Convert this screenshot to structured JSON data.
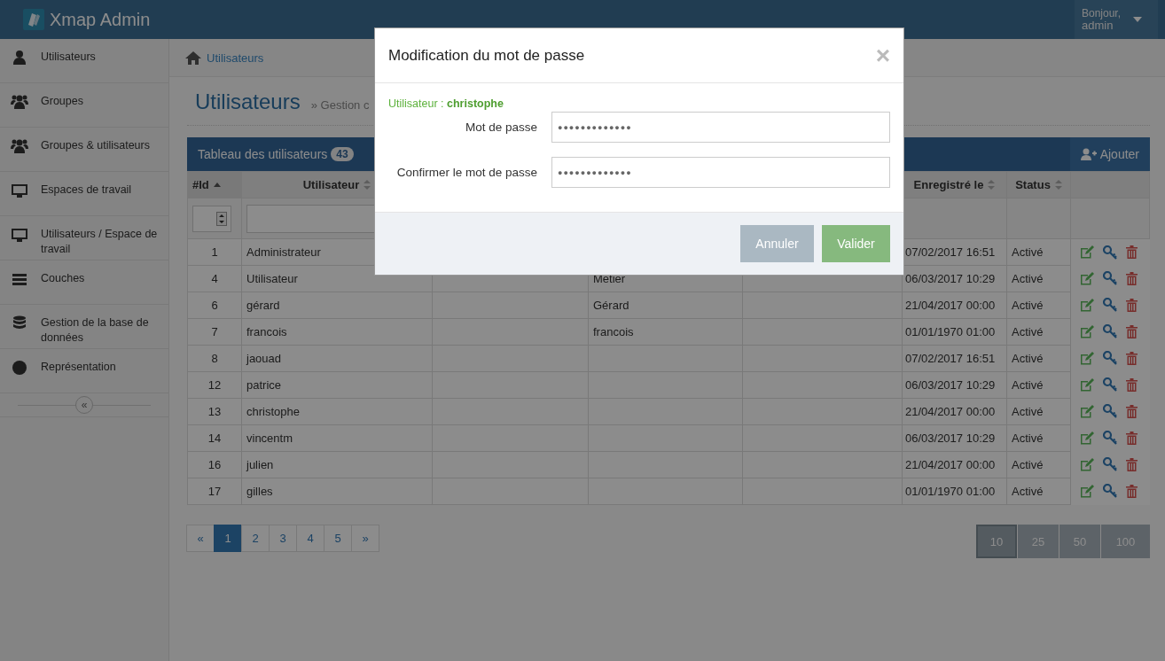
{
  "app": {
    "title": "Xmap Admin",
    "greeting": "Bonjour,",
    "user": "admin"
  },
  "sidebar": {
    "items": [
      {
        "label": "Utilisateurs"
      },
      {
        "label": "Groupes"
      },
      {
        "label": "Groupes & utilisateurs"
      },
      {
        "label": "Espaces de travail"
      },
      {
        "label": "Utilisateurs / Espace de travail"
      },
      {
        "label": "Couches"
      },
      {
        "label": "Gestion de la base de données"
      },
      {
        "label": "Représentation"
      }
    ],
    "collapse": "«"
  },
  "breadcrumb": "Utilisateurs",
  "page": {
    "title": "Utilisateurs",
    "subtitle": "» Gestion c"
  },
  "panel": {
    "title": "Tableau des utilisateurs",
    "count": "43",
    "add_button": "Ajouter"
  },
  "table": {
    "columns": [
      "#Id",
      "Utilisateur",
      "Enregistré le",
      "Status"
    ],
    "rows": [
      {
        "id": "1",
        "user": "Administrateur",
        "registered": "07/02/2017 16:51",
        "status": "Activé"
      },
      {
        "id": "4",
        "user": "Utilisateur",
        "column_4": "Metier",
        "registered": "06/03/2017 10:29",
        "status": "Activé"
      },
      {
        "id": "6",
        "user": "gérard",
        "column_4": "Gérard",
        "registered": "21/04/2017 00:00",
        "status": "Activé"
      },
      {
        "id": "7",
        "user": "francois",
        "column_4": "francois",
        "registered": "01/01/1970 01:00",
        "status": "Activé"
      },
      {
        "id": "8",
        "user": "jaouad",
        "registered": "07/02/2017 16:51",
        "status": "Activé"
      },
      {
        "id": "12",
        "user": "patrice",
        "registered": "06/03/2017 10:29",
        "status": "Activé"
      },
      {
        "id": "13",
        "user": "christophe",
        "registered": "21/04/2017 00:00",
        "status": "Activé"
      },
      {
        "id": "14",
        "user": "vincentm",
        "registered": "06/03/2017 10:29",
        "status": "Activé"
      },
      {
        "id": "16",
        "user": "julien",
        "registered": "21/04/2017 00:00",
        "status": "Activé"
      },
      {
        "id": "17",
        "user": "gilles",
        "registered": "01/01/1970 01:00",
        "status": "Activé"
      }
    ]
  },
  "pagination": {
    "prev": "«",
    "next": "»",
    "pages": [
      {
        "label": "1",
        "selected": true
      },
      {
        "label": "2",
        "selected": false
      },
      {
        "label": "3",
        "selected": false
      },
      {
        "label": "4",
        "selected": false
      },
      {
        "label": "5",
        "selected": false
      }
    ]
  },
  "page_sizes": [
    {
      "label": "10",
      "selected": true
    },
    {
      "label": "25",
      "selected": false
    },
    {
      "label": "50",
      "selected": false
    },
    {
      "label": "100",
      "selected": false
    }
  ],
  "dialog": {
    "title": "Modification du mot de passe",
    "close": "×",
    "user_label": "Utilisateur :",
    "user_name": "christophe",
    "fields": [
      {
        "label": "Mot de passe",
        "value": "●●●●●●●●●●●●●"
      },
      {
        "label": "Confirmer le mot de passe",
        "value": "●●●●●●●●●●●●●"
      }
    ],
    "buttons": [
      {
        "label": "Annuler",
        "kind": "cancel"
      },
      {
        "label": "Valider",
        "kind": "confirm"
      }
    ]
  }
}
